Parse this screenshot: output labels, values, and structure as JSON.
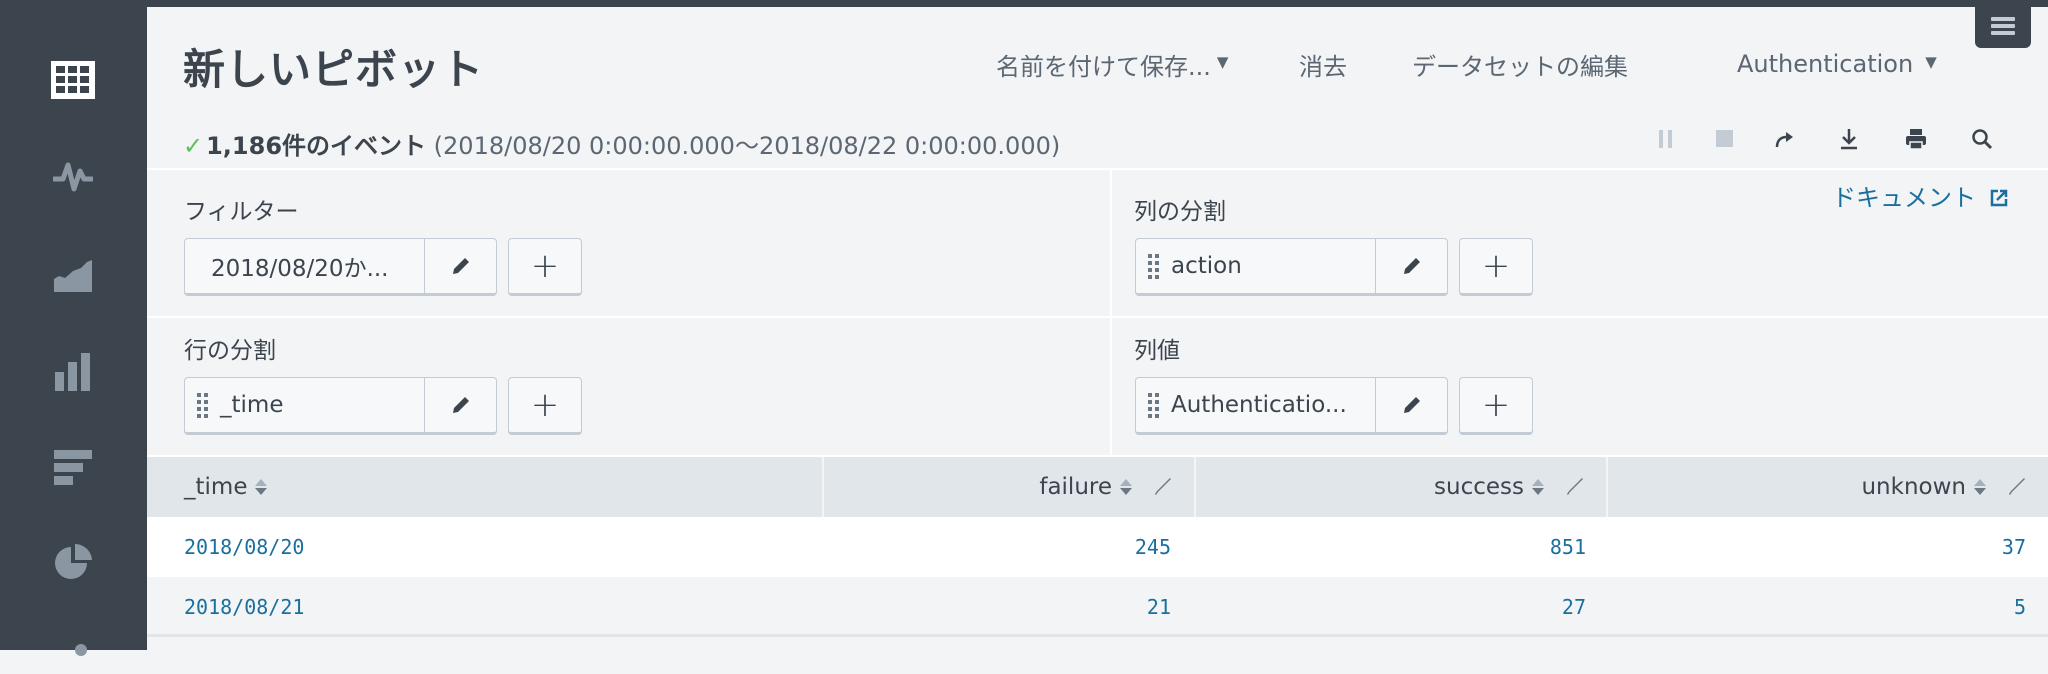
{
  "header": {
    "title": "新しいピボット",
    "actions": {
      "save_as": "名前を付けて保存...",
      "clear": "消去",
      "edit_dataset": "データセットの編集",
      "dataset": "Authentication"
    },
    "menu_icon": "hamburger-menu-icon"
  },
  "status": {
    "check_icon": "✓",
    "event_count": "1,186件のイベント",
    "range": "(2018/08/20 0:00:00.000〜2018/08/22 0:00:00.000)"
  },
  "job_controls": [
    "pause-icon",
    "stop-icon",
    "share-icon",
    "export-icon",
    "print-icon",
    "inspect-icon"
  ],
  "sidebar": {
    "items": [
      {
        "icon": "table-icon",
        "active": true
      },
      {
        "icon": "single-value-icon"
      },
      {
        "icon": "area-chart-icon"
      },
      {
        "icon": "column-chart-icon"
      },
      {
        "icon": "bar-chart-icon"
      },
      {
        "icon": "pie-chart-icon"
      },
      {
        "icon": "scatter-chart-icon"
      }
    ]
  },
  "panels": {
    "filter": {
      "label": "フィルター",
      "value": "2018/08/20か..."
    },
    "row_split": {
      "label": "行の分割",
      "value": "_time"
    },
    "column_split": {
      "label": "列の分割",
      "value": "action"
    },
    "column_values": {
      "label": "列値",
      "value": "Authenticatio..."
    },
    "add_label": "+"
  },
  "doc_link": {
    "label": "ドキュメント",
    "icon": "external-link-icon"
  },
  "table": {
    "columns": [
      "_time",
      "failure",
      "success",
      "unknown"
    ],
    "rows": [
      [
        "2018/08/20",
        "245",
        "851",
        "37"
      ],
      [
        "2018/08/21",
        "21",
        "27",
        "5"
      ]
    ]
  },
  "colors": {
    "sidebar_bg": "#3c444d",
    "page_bg": "#f2f4f5",
    "link_blue": "#1a6f9f",
    "success_green": "#5cc05c",
    "table_header_bg": "#e1e6eb"
  }
}
